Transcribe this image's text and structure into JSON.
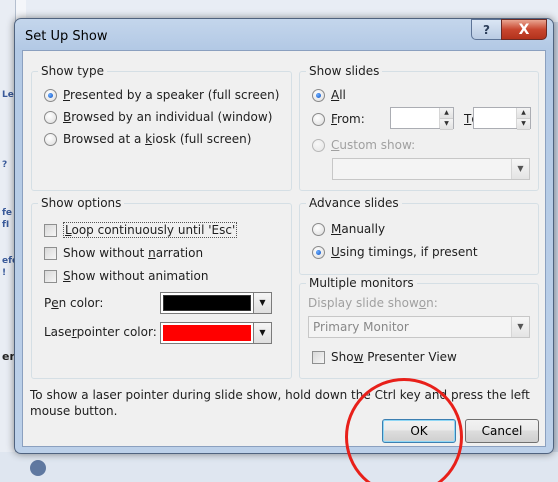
{
  "background": {
    "left_fragments": [
      "Le",
      "?",
      "fe",
      "fI",
      "efe",
      "!",
      "en"
    ]
  },
  "dialog": {
    "title": "Set Up Show",
    "help_button": "?",
    "close_button": "X"
  },
  "show_type": {
    "title": "Show type",
    "options": [
      {
        "pre": "",
        "u": "P",
        "post": "resented by a speaker (full screen)",
        "selected": true
      },
      {
        "pre": "",
        "u": "B",
        "post": "rowsed by an individual (window)",
        "selected": false
      },
      {
        "pre": "Browsed at a ",
        "u": "k",
        "post": "iosk (full screen)",
        "selected": false
      }
    ]
  },
  "show_slides": {
    "title": "Show slides",
    "all": {
      "pre": "",
      "u": "A",
      "post": "ll"
    },
    "from": {
      "pre": "",
      "u": "F",
      "post": "rom:"
    },
    "to": {
      "pre": "",
      "u": "T",
      "post": "o:"
    },
    "from_value": "",
    "to_value": "",
    "custom": {
      "pre": "",
      "u": "C",
      "post": "ustom show:"
    },
    "custom_value": ""
  },
  "show_options": {
    "title": "Show options",
    "options": [
      {
        "pre": "",
        "u": "L",
        "post": "oop continuously until 'Esc'"
      },
      {
        "pre": "Show without ",
        "u": "n",
        "post": "arration"
      },
      {
        "pre": "",
        "u": "S",
        "post": "how without animation"
      }
    ],
    "pen_color": {
      "pre": "P",
      "u": "e",
      "post": "n color:",
      "color": "#000000"
    },
    "laser_color": {
      "pre": "Lase",
      "u": "r",
      "post": " pointer color:",
      "color": "#ff0000"
    }
  },
  "advance_slides": {
    "title": "Advance slides",
    "options": [
      {
        "pre": "",
        "u": "M",
        "post": "anually",
        "selected": false
      },
      {
        "pre": "",
        "u": "U",
        "post": "sing timings, if present",
        "selected": true
      }
    ]
  },
  "multiple_monitors": {
    "title": "Multiple monitors",
    "display_label": {
      "pre": "Display slide show ",
      "u": "o",
      "post": "n:"
    },
    "display_value": "Primary Monitor",
    "presenter_view": {
      "pre": "Sho",
      "u": "w",
      "post": " Presenter View"
    }
  },
  "hint": "To show a laser pointer during slide show, hold down the Ctrl key and press the left mouse button.",
  "buttons": {
    "ok": "OK",
    "cancel": "Cancel"
  },
  "colors": {
    "annotation": "#e8201a",
    "close_button": "#c8462f",
    "selected_radio": "#0b4fc2"
  }
}
